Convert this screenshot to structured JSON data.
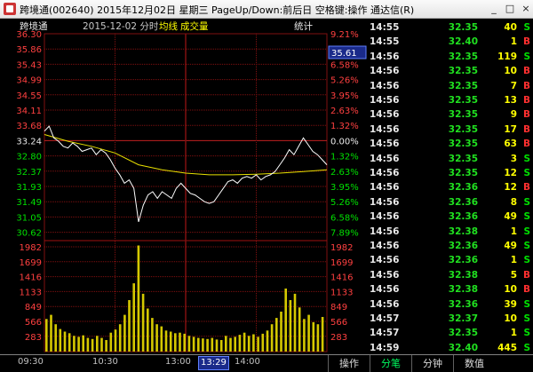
{
  "window": {
    "title": "跨境通(002640) 2015年12月02日 星期三 PageUp/Down:前后日 空格键:操作 通达信(R)",
    "controls": [
      "_",
      "□",
      "×"
    ]
  },
  "chart_header": {
    "name": "跨境通",
    "date": "2015-12-02 分时",
    "avg_label": "均线",
    "vol_label": "成交量",
    "stats_label": "统计"
  },
  "colors": {
    "background": "#000000",
    "up": "#ff4040",
    "down": "#00e000",
    "price_line": "#ffffff",
    "avg_line": "#ffff00",
    "volume": "#d4c800",
    "grid": "#801010"
  },
  "price_axis": {
    "left_labels": [
      "36.30",
      "35.86",
      "35.43",
      "34.99",
      "34.55",
      "34.11",
      "33.68",
      "33.24",
      "32.80",
      "32.37",
      "31.93",
      "31.49",
      "31.05",
      "30.62"
    ],
    "right_labels": [
      "9.21%",
      "7.89%",
      "6.58%",
      "5.26%",
      "3.95%",
      "2.63%",
      "1.32%",
      "0.00%",
      "1.32%",
      "2.63%",
      "3.95%",
      "5.26%",
      "6.58%",
      "7.89%"
    ],
    "cursor_price": "35.61",
    "prev_close": "33.24"
  },
  "volume_axis": {
    "left_labels": [
      "1982",
      "1699",
      "1416",
      "1133",
      "849",
      "566",
      "283"
    ],
    "right_labels": [
      "1982",
      "1699",
      "1416",
      "1133",
      "849",
      "566",
      "283"
    ]
  },
  "time_axis": {
    "labels": [
      "09:30",
      "10:30",
      "13:00",
      "14:00"
    ],
    "cursor_time": "13:29"
  },
  "chart_data": {
    "type": "line",
    "title": "跨境通 2015-12-02 分时",
    "ylim": [
      30.18,
      36.3
    ],
    "volume_ylim": [
      0,
      2265
    ],
    "series": [
      {
        "name": "价格",
        "x": [
          0,
          4,
          8,
          12,
          16,
          20,
          24,
          28,
          32,
          36,
          40,
          44,
          48,
          52,
          56,
          60,
          64,
          68,
          72,
          76,
          80,
          84,
          88,
          92,
          96,
          100,
          104,
          108,
          112,
          116,
          120,
          124,
          128,
          132,
          136,
          140,
          144,
          148,
          152,
          156,
          160,
          164,
          168,
          172,
          176,
          180,
          184,
          188,
          192,
          196,
          200,
          204,
          208,
          212,
          216,
          220,
          224,
          228,
          232,
          236,
          240
        ],
        "values": [
          33.4,
          33.55,
          33.2,
          33.1,
          32.95,
          32.9,
          33.05,
          32.95,
          32.8,
          32.85,
          32.9,
          32.7,
          32.85,
          32.75,
          32.55,
          32.3,
          32.1,
          31.85,
          31.95,
          31.7,
          30.7,
          31.2,
          31.5,
          31.6,
          31.4,
          31.6,
          31.5,
          31.4,
          31.7,
          31.85,
          31.7,
          31.55,
          31.5,
          31.4,
          31.3,
          31.25,
          31.3,
          31.5,
          31.7,
          31.9,
          31.95,
          31.85,
          32.0,
          32.05,
          32.0,
          32.1,
          31.95,
          32.05,
          32.1,
          32.2,
          32.4,
          32.6,
          32.85,
          32.7,
          32.95,
          33.2,
          33.0,
          32.8,
          32.7,
          32.55,
          32.4
        ]
      },
      {
        "name": "均线",
        "x": [
          0,
          20,
          40,
          60,
          80,
          100,
          120,
          140,
          160,
          180,
          200,
          220,
          240
        ],
        "values": [
          33.3,
          33.1,
          32.95,
          32.75,
          32.4,
          32.25,
          32.15,
          32.1,
          32.1,
          32.12,
          32.15,
          32.2,
          32.25
        ]
      }
    ],
    "volume": [
      620,
      700,
      520,
      430,
      380,
      350,
      300,
      280,
      310,
      260,
      240,
      300,
      260,
      220,
      360,
      420,
      520,
      700,
      980,
      1300,
      2020,
      1100,
      820,
      640,
      520,
      480,
      400,
      380,
      350,
      360,
      340,
      300,
      280,
      260,
      250,
      240,
      260,
      230,
      220,
      300,
      260,
      280,
      320,
      360,
      300,
      330,
      280,
      340,
      400,
      520,
      640,
      760,
      1200,
      980,
      1100,
      840,
      620,
      700,
      560,
      520,
      660
    ]
  },
  "trades": [
    {
      "time": "14:55",
      "price": "32.35",
      "volume": "40",
      "flag": "S"
    },
    {
      "time": "14:55",
      "price": "32.40",
      "volume": "1",
      "flag": "B"
    },
    {
      "time": "14:56",
      "price": "32.35",
      "volume": "119",
      "flag": "S"
    },
    {
      "time": "14:56",
      "price": "32.35",
      "volume": "10",
      "flag": "B"
    },
    {
      "time": "14:56",
      "price": "32.35",
      "volume": "7",
      "flag": "B"
    },
    {
      "time": "14:56",
      "price": "32.35",
      "volume": "13",
      "flag": "B"
    },
    {
      "time": "14:56",
      "price": "32.35",
      "volume": "9",
      "flag": "B"
    },
    {
      "time": "14:56",
      "price": "32.35",
      "volume": "17",
      "flag": "B"
    },
    {
      "time": "14:56",
      "price": "32.35",
      "volume": "63",
      "flag": "B"
    },
    {
      "time": "14:56",
      "price": "32.35",
      "volume": "3",
      "flag": "S"
    },
    {
      "time": "14:56",
      "price": "32.35",
      "volume": "12",
      "flag": "S"
    },
    {
      "time": "14:56",
      "price": "32.36",
      "volume": "12",
      "flag": "B"
    },
    {
      "time": "14:56",
      "price": "32.36",
      "volume": "8",
      "flag": "S"
    },
    {
      "time": "14:56",
      "price": "32.36",
      "volume": "49",
      "flag": "S"
    },
    {
      "time": "14:56",
      "price": "32.38",
      "volume": "1",
      "flag": "S"
    },
    {
      "time": "14:56",
      "price": "32.36",
      "volume": "49",
      "flag": "S"
    },
    {
      "time": "14:56",
      "price": "32.36",
      "volume": "1",
      "flag": "S"
    },
    {
      "time": "14:56",
      "price": "32.38",
      "volume": "5",
      "flag": "B"
    },
    {
      "time": "14:56",
      "price": "32.38",
      "volume": "10",
      "flag": "B"
    },
    {
      "time": "14:56",
      "price": "32.36",
      "volume": "39",
      "flag": "S"
    },
    {
      "time": "14:57",
      "price": "32.37",
      "volume": "10",
      "flag": "S"
    },
    {
      "time": "14:57",
      "price": "32.35",
      "volume": "1",
      "flag": "S"
    },
    {
      "time": "14:59",
      "price": "32.40",
      "volume": "445",
      "flag": "S"
    }
  ],
  "bottom_tabs": [
    "操作",
    "分笔",
    "分钟",
    "数值"
  ],
  "bottom_active_tab": 1
}
